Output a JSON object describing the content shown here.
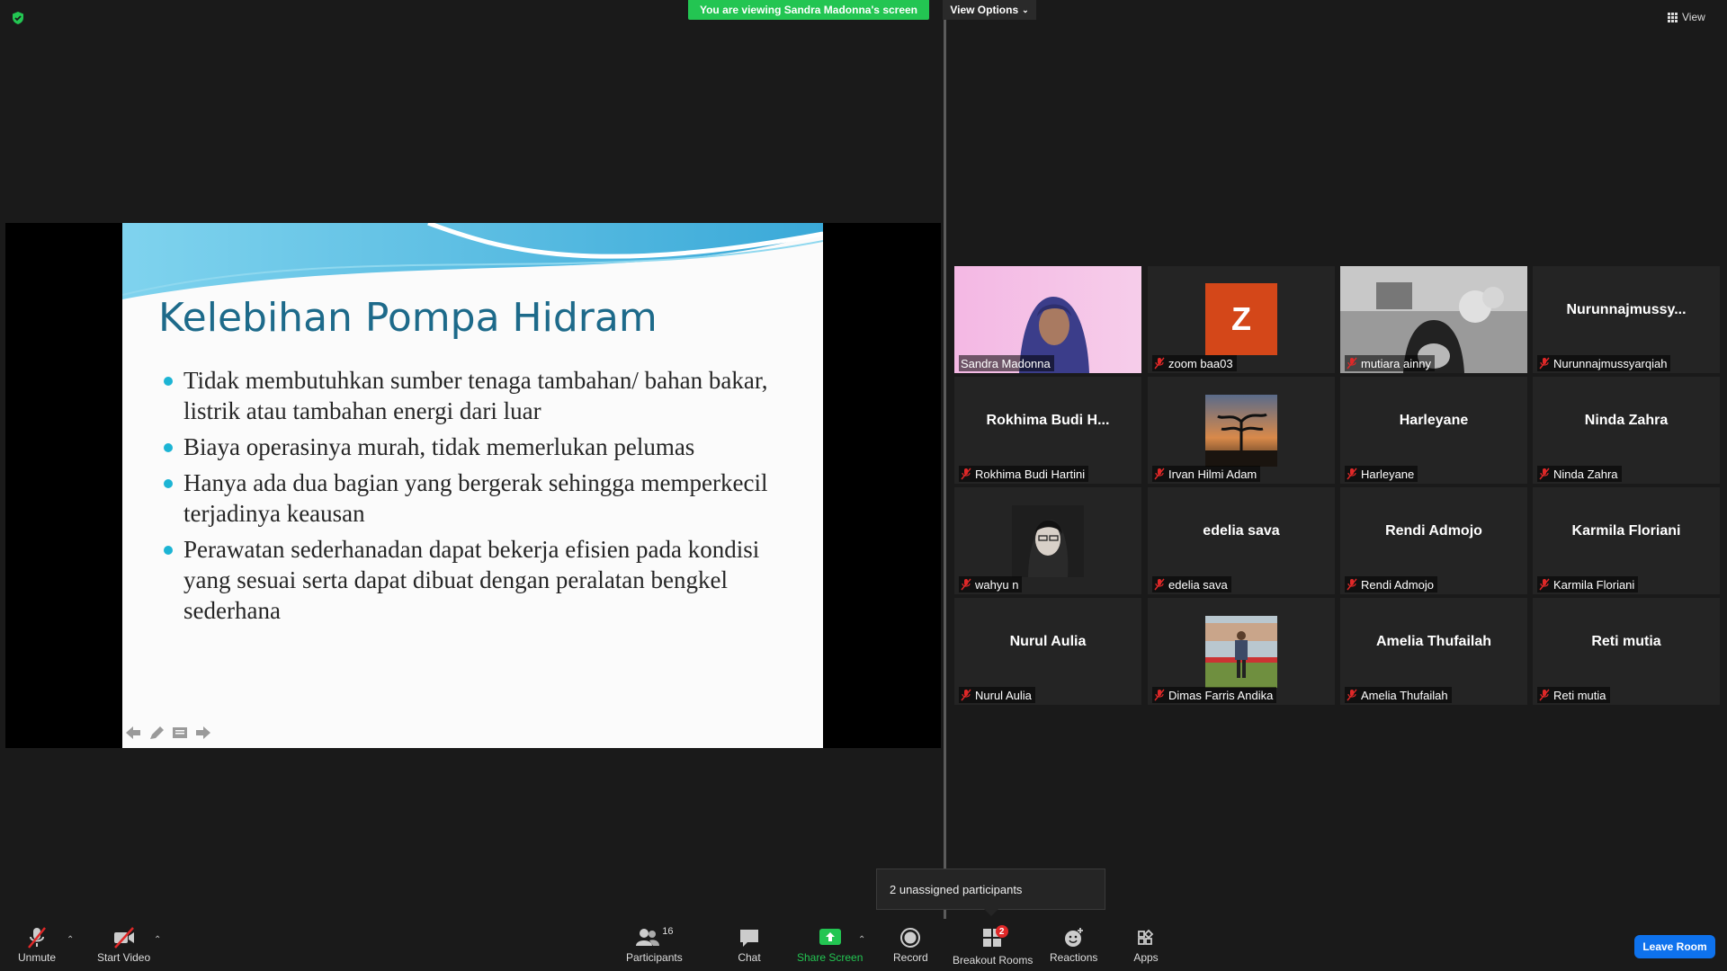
{
  "banner": {
    "viewing": "You are viewing Sandra Madonna's screen",
    "view_options": "View Options",
    "view": "View"
  },
  "slide": {
    "title": "Kelebihan Pompa Hidram",
    "bullets": [
      "Tidak membutuhkan sumber tenaga tambahan/ bahan bakar, listrik atau tambahan energi dari luar",
      "Biaya operasinya murah, tidak memerlukan pelumas",
      "Hanya ada dua bagian yang bergerak sehingga memperkecil terjadinya keausan",
      "Perawatan sederhanadan dapat bekerja efisien pada kondisi yang sesuai serta dapat dibuat dengan peralatan bengkel sederhana"
    ]
  },
  "participants": [
    {
      "name": "Sandra Madonna",
      "big": "",
      "muted": false,
      "type": "video"
    },
    {
      "name": "zoom baa03",
      "big": "",
      "muted": true,
      "type": "avatar",
      "initial": "Z"
    },
    {
      "name": "mutiara ainny",
      "big": "",
      "muted": true,
      "type": "video-gray"
    },
    {
      "name": "Nurunnajmussyarqiah",
      "big": "Nurunnajmussy...",
      "muted": true,
      "type": "name"
    },
    {
      "name": "Rokhima Budi Hartini",
      "big": "Rokhima Budi H...",
      "muted": true,
      "type": "name"
    },
    {
      "name": "Irvan Hilmi Adam",
      "big": "",
      "muted": true,
      "type": "photo-sunset"
    },
    {
      "name": "Harleyane",
      "big": "Harleyane",
      "muted": true,
      "type": "name"
    },
    {
      "name": "Ninda Zahra",
      "big": "Ninda Zahra",
      "muted": true,
      "type": "name"
    },
    {
      "name": "wahyu n",
      "big": "",
      "muted": true,
      "type": "photo-person"
    },
    {
      "name": "edelia sava",
      "big": "edelia sava",
      "muted": true,
      "type": "name"
    },
    {
      "name": "Rendi Admojo",
      "big": "Rendi Admojo",
      "muted": true,
      "type": "name"
    },
    {
      "name": "Karmila Floriani",
      "big": "Karmila Floriani",
      "muted": true,
      "type": "name"
    },
    {
      "name": "Nurul Aulia",
      "big": "Nurul Aulia",
      "muted": true,
      "type": "name"
    },
    {
      "name": "Dimas Farris Andika",
      "big": "",
      "muted": true,
      "type": "photo-field"
    },
    {
      "name": "Amelia Thufailah",
      "big": "Amelia Thufailah",
      "muted": true,
      "type": "name"
    },
    {
      "name": "Reti mutia",
      "big": "Reti mutia",
      "muted": true,
      "type": "name"
    }
  ],
  "toast": "2 unassigned participants",
  "toolbar": {
    "unmute": "Unmute",
    "start_video": "Start Video",
    "participants": "Participants",
    "participant_count": "16",
    "chat": "Chat",
    "share_screen": "Share Screen",
    "record": "Record",
    "breakout_rooms": "Breakout Rooms",
    "breakout_badge": "2",
    "reactions": "Reactions",
    "apps": "Apps",
    "leave": "Leave Room"
  },
  "colors": {
    "share_green": "#23c552",
    "leave_blue": "#0e72ed",
    "active_speaker": "#e8e361",
    "avatar_orange": "#d44719"
  }
}
